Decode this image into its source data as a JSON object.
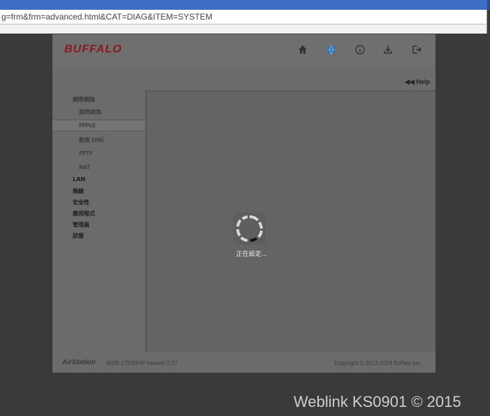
{
  "browser": {
    "url": "g=frm&frm=advanced.html&CAT=DIAG&ITEM=SYSTEM"
  },
  "router": {
    "logo": "BUFFALO",
    "help_label": "Help",
    "header_icons": [
      "home-icon",
      "globe-icon",
      "info-icon",
      "download-icon",
      "logout-icon"
    ],
    "nav": {
      "group_internet": "網際網路",
      "sub_internet": "網際網路",
      "sub_pppoe": "PPPoE",
      "sub_ddns": "動態 DNS",
      "sub_pptp": "PPTP",
      "sub_nat": "NAT",
      "lan": "LAN",
      "wireless": "無線",
      "security": "安全性",
      "applications": "應用程式",
      "admin": "管理員",
      "status": "狀態"
    },
    "loading_text": "正在設定...",
    "footer": {
      "brand": "AirStation",
      "model": "WZR-1750DHP  Version 2.27",
      "copyright": "Copyright © 2013-2014 Buffalo Inc."
    }
  },
  "watermark": "Weblink KS0901 © 2015",
  "colors": {
    "logo": "#8a1a1a",
    "globe_icon": "#2f6fb3",
    "page_bg": "#3a3a3a"
  }
}
